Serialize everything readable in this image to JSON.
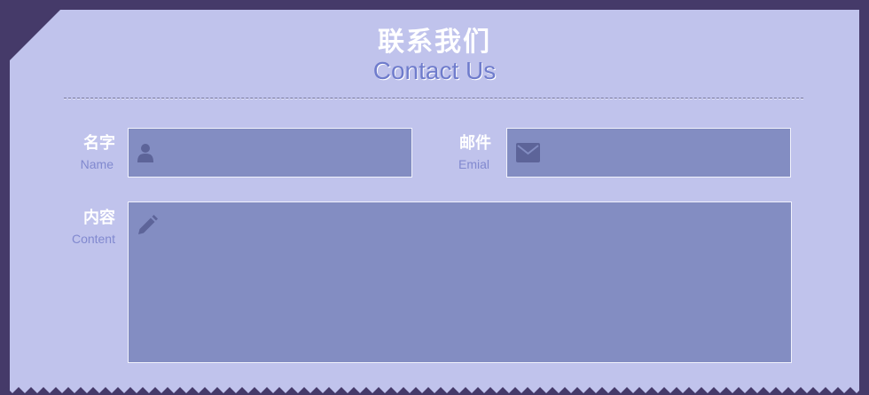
{
  "header": {
    "title_cn": "联系我们",
    "title_en": "Contact Us"
  },
  "form": {
    "name": {
      "label_cn": "名字",
      "label_en": "Name",
      "value": "",
      "icon": "user-icon"
    },
    "email": {
      "label_cn": "邮件",
      "label_en": "Emial",
      "value": "",
      "icon": "envelope-icon"
    },
    "content": {
      "label_cn": "内容",
      "label_en": "Content",
      "value": "",
      "icon": "pencil-icon"
    }
  },
  "colors": {
    "background": "#453a69",
    "card": "#c0c3ec",
    "field": "#838dc2",
    "accent": "#6f7ccc"
  }
}
